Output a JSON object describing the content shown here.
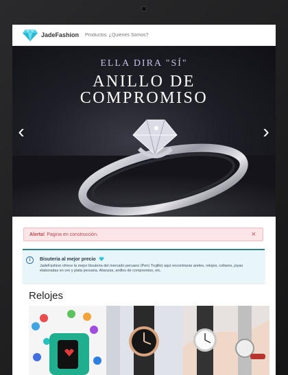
{
  "navbar": {
    "brand": "JadeFashion",
    "links": [
      "Productos",
      "¿Quienes Somos?"
    ]
  },
  "hero": {
    "subtitle": "ELLA DIRA \"SÍ\"",
    "title_line1": "ANILLO DE",
    "title_line2": "COMPROMISO",
    "prev_label": "‹",
    "next_label": "›"
  },
  "alert": {
    "strong": "Alerta!",
    "text": "Pagina en construcción.",
    "close": "×"
  },
  "info": {
    "title": "Bisuteria al mejor precio",
    "text": "JadeFashion ofrece la mejor bisuteria del mercado peruano (Perú Trujillo) aquí encontraras aretes, relojes, collares, joyas elaboradas en oro y plata peruana. Alianzas, anillos de compromiso, etc."
  },
  "section": {
    "title": "Relojes"
  },
  "colors": {
    "accent": "#2a7f8b",
    "alert_bg": "#fbe5e6",
    "info_bg": "#e8f6fa",
    "gem": "#4fd3e8"
  }
}
